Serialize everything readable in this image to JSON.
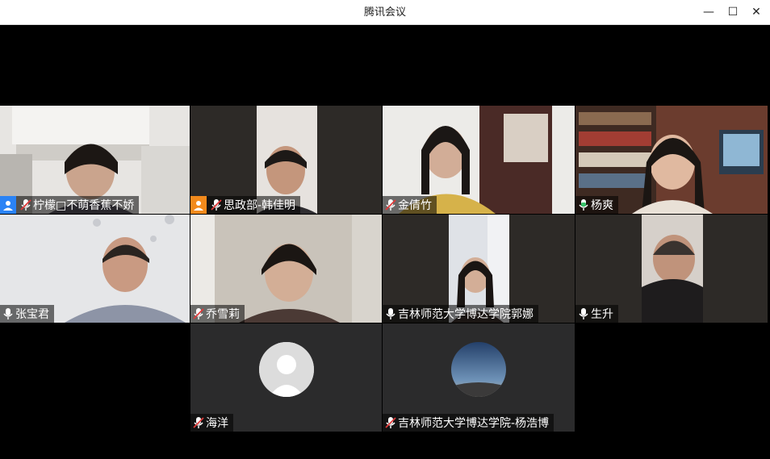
{
  "window": {
    "title": "腾讯会议",
    "minimize_glyph": "—",
    "maximize_glyph": "☐",
    "close_glyph": "✕"
  },
  "participants": [
    {
      "name": "柠檬□不萌香蕉不娇",
      "mic": "muted",
      "badge": "host-blue"
    },
    {
      "name": "思政部-韩佳明",
      "mic": "muted",
      "badge": "cohost-orange"
    },
    {
      "name": "金倩竹",
      "mic": "muted",
      "badge": null
    },
    {
      "name": "杨爽",
      "mic": "speaking",
      "badge": null,
      "active": true
    },
    {
      "name": "张宝君",
      "mic": "on",
      "badge": null
    },
    {
      "name": "乔雪莉",
      "mic": "muted",
      "badge": null
    },
    {
      "name": "吉林师范大学博达学院郭娜",
      "mic": "on",
      "badge": null
    },
    {
      "name": "生升",
      "mic": "on",
      "badge": null
    },
    {
      "name": "海洋",
      "mic": "muted",
      "badge": null,
      "video": "off"
    },
    {
      "name": "吉林师范大学博达学院-杨浩博",
      "mic": "muted",
      "badge": null,
      "video": "off"
    }
  ],
  "colors": {
    "active_border": "#2fbf6b",
    "host_badge": "#2a83f5",
    "cohost_badge": "#f28a1c",
    "muted_mic": "#e03a3a",
    "speaking_mic": "#38c26a"
  }
}
